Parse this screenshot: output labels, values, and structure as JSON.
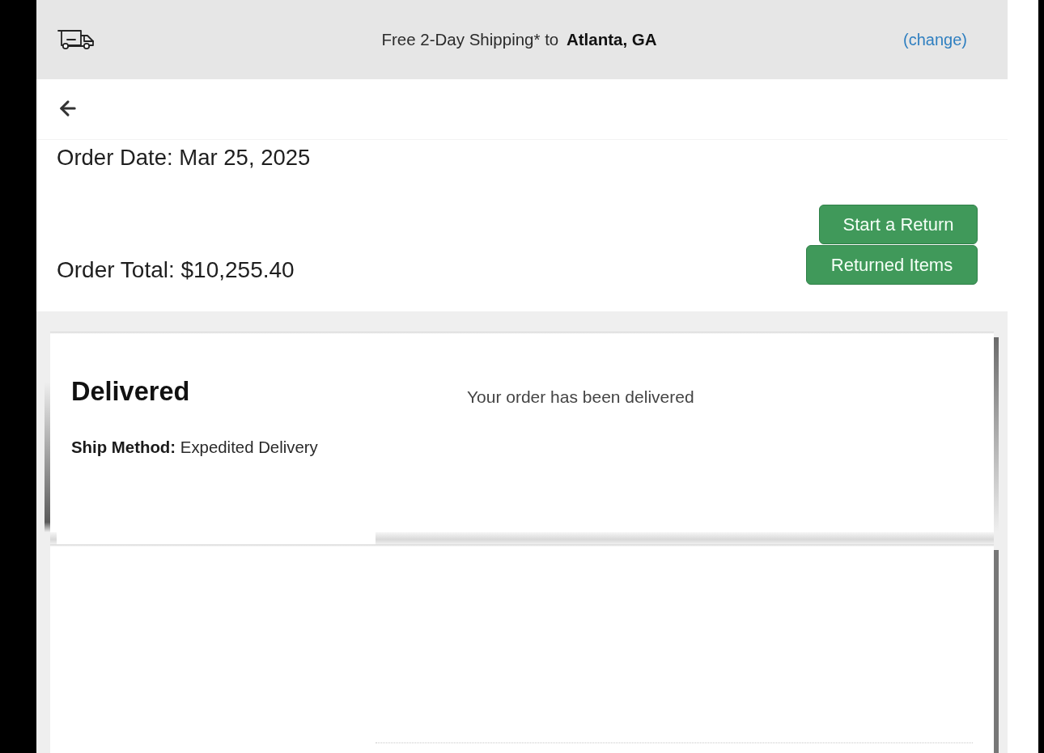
{
  "shipping_bar": {
    "message": "Free 2-Day Shipping* to **Atlanta, GA**",
    "link": "(change)"
  },
  "order": {
    "date": "Order Date: Mar 25, 2025",
    "total": "Order Total: $10,255.40",
    "buttons": [
      "Start a Return",
      "Returned Items"
    ]
  },
  "shipment": {
    "status": "Delivered",
    "ship_method": "**Ship Method:** Expedited Delivery",
    "message": "Your order has been delivered"
  }
}
